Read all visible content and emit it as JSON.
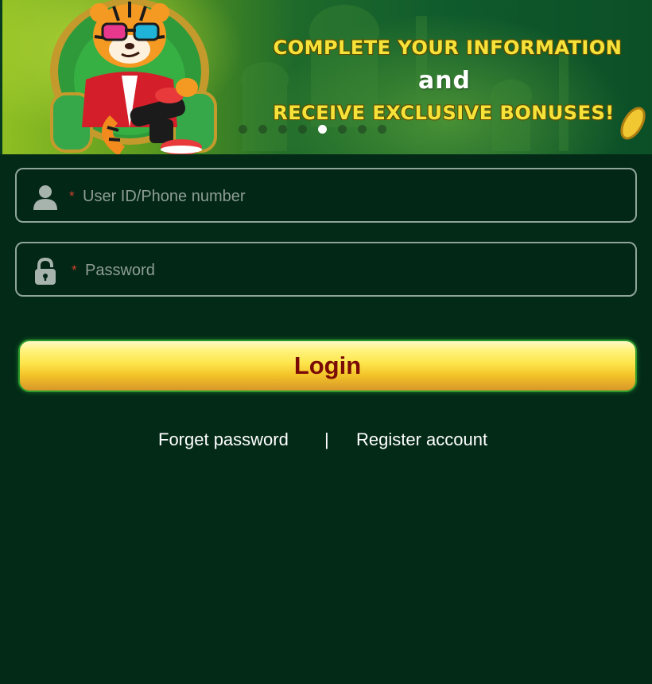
{
  "banner": {
    "line1": "COMPLETE YOUR INFORMATION",
    "line2": "and",
    "line3": "RECEIVE EXCLUSIVE BONUSES!",
    "carousel_total": 8,
    "carousel_active": 5
  },
  "form": {
    "username_placeholder": "User ID/Phone number",
    "username_value": "",
    "password_placeholder": "Password",
    "password_value": "",
    "required_mark": "*",
    "login_label": "Login"
  },
  "links": {
    "forget": "Forget password",
    "separator": "|",
    "register": "Register account"
  },
  "icons": {
    "user": "user-icon",
    "password": "lock-icon"
  },
  "colors": {
    "background": "#032a17",
    "required": "#d2422a",
    "login_text": "#7a0b06",
    "banner_headline": "#f6e33a"
  }
}
